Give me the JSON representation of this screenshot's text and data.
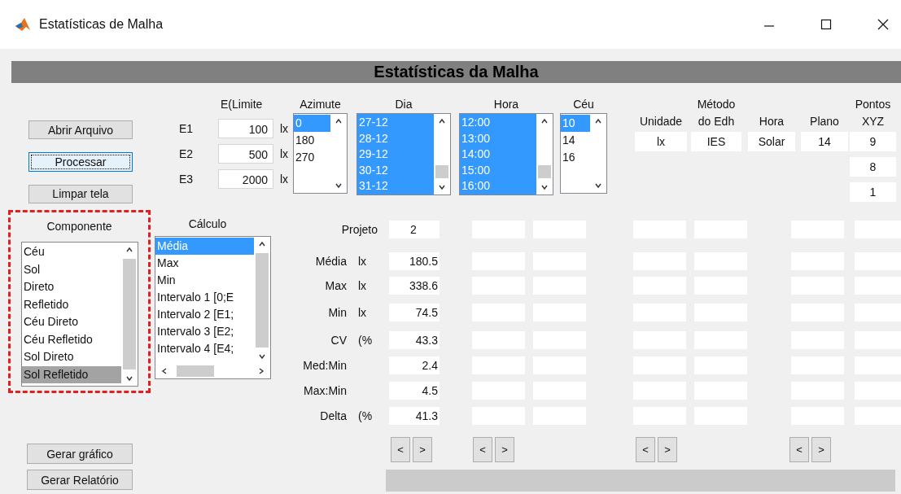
{
  "window": {
    "title": "Estatísticas de Malha"
  },
  "banner": "Estatísticas da Malha",
  "actions": [
    {
      "label": "Abrir Arquivo",
      "focused": false
    },
    {
      "label": "Processar",
      "focused": true
    },
    {
      "label": "Limpar tela",
      "focused": false
    }
  ],
  "limits": {
    "heading": "E(Limite",
    "rows": [
      {
        "label": "E1",
        "value": "100",
        "unit": "lx"
      },
      {
        "label": "E2",
        "value": "500",
        "unit": "lx"
      },
      {
        "label": "E3",
        "value": "2000",
        "unit": "lx"
      }
    ]
  },
  "lists": [
    {
      "kind": "azimute",
      "heading": "Azimute",
      "focused": true,
      "items": [
        {
          "text": "0",
          "selected": true
        },
        {
          "text": "180",
          "selected": false
        },
        {
          "text": "270",
          "selected": false
        }
      ]
    },
    {
      "kind": "dia",
      "heading": "Dia",
      "focused": true,
      "items": [
        {
          "text": "27-12",
          "selected": true
        },
        {
          "text": "28-12",
          "selected": true
        },
        {
          "text": "29-12",
          "selected": true
        },
        {
          "text": "30-12",
          "selected": true
        },
        {
          "text": "31-12",
          "selected": true
        }
      ]
    },
    {
      "kind": "hora",
      "heading": "Hora",
      "focused": true,
      "items": [
        {
          "text": "12:00",
          "selected": true
        },
        {
          "text": "13:00",
          "selected": true
        },
        {
          "text": "14:00",
          "selected": true
        },
        {
          "text": "15:00",
          "selected": true
        },
        {
          "text": "16:00",
          "selected": true
        }
      ]
    },
    {
      "kind": "ceu",
      "heading": "Céu",
      "focused": true,
      "items": [
        {
          "text": "10",
          "selected": true
        },
        {
          "text": "14",
          "selected": false
        },
        {
          "text": "16",
          "selected": false
        }
      ]
    }
  ],
  "info": [
    {
      "heading": "Unidade",
      "values": [
        "lx"
      ]
    },
    {
      "heading": "Método do Edh",
      "values": [
        "IES"
      ]
    },
    {
      "heading": "Hora",
      "values": [
        "Solar"
      ]
    },
    {
      "heading": "Plano",
      "values": [
        "14"
      ]
    },
    {
      "heading": "Pontos XYZ",
      "values": [
        "9",
        "8",
        "1"
      ]
    }
  ],
  "componente": {
    "heading": "Componente",
    "focused": false,
    "items": [
      {
        "text": "Céu",
        "selected": false
      },
      {
        "text": "Sol",
        "selected": false
      },
      {
        "text": "Direto",
        "selected": false
      },
      {
        "text": "Refletido",
        "selected": false
      },
      {
        "text": "Céu Direto",
        "selected": false
      },
      {
        "text": "Céu Refletido",
        "selected": false
      },
      {
        "text": "Sol Direto",
        "selected": false
      },
      {
        "text": "Sol Refletido",
        "selected": true
      }
    ]
  },
  "calculo": {
    "heading": "Cálculo",
    "focused": true,
    "items": [
      {
        "text": "Média",
        "selected": true
      },
      {
        "text": "Max",
        "selected": false
      },
      {
        "text": "Min",
        "selected": false
      },
      {
        "text": "Intervalo 1 [0;E",
        "selected": false
      },
      {
        "text": "Intervalo 2 [E1;",
        "selected": false
      },
      {
        "text": "Intervalo 3 [E2;",
        "selected": false
      },
      {
        "text": "Intervalo 4 [E4;",
        "selected": false
      }
    ]
  },
  "stats": [
    {
      "kind": "header",
      "label": "Projeto",
      "value": "2"
    },
    {
      "kind": "stat",
      "label": "Média",
      "unit": "lx",
      "value": "180.5"
    },
    {
      "kind": "stat",
      "label": "Max",
      "unit": "lx",
      "value": "338.6"
    },
    {
      "kind": "stat",
      "label": "Min",
      "unit": "lx",
      "value": "74.5"
    },
    {
      "kind": "stat",
      "label": "CV",
      "unit": "(%",
      "value": "43.3"
    },
    {
      "kind": "stat",
      "label": "Med:Min",
      "value": "2.4"
    },
    {
      "kind": "stat",
      "label": "Max:Min",
      "value": "4.5"
    },
    {
      "kind": "stat",
      "label": "Delta",
      "unit": "(%",
      "value": "41.3"
    }
  ],
  "pagers": [
    {
      "prev": "<",
      "next": ">"
    },
    {
      "prev": "<",
      "next": ">"
    },
    {
      "prev": "<",
      "next": ">"
    },
    {
      "prev": "<",
      "next": ">"
    }
  ],
  "reports": [
    "Gerar gráfico",
    "Gerar Relatório"
  ]
}
